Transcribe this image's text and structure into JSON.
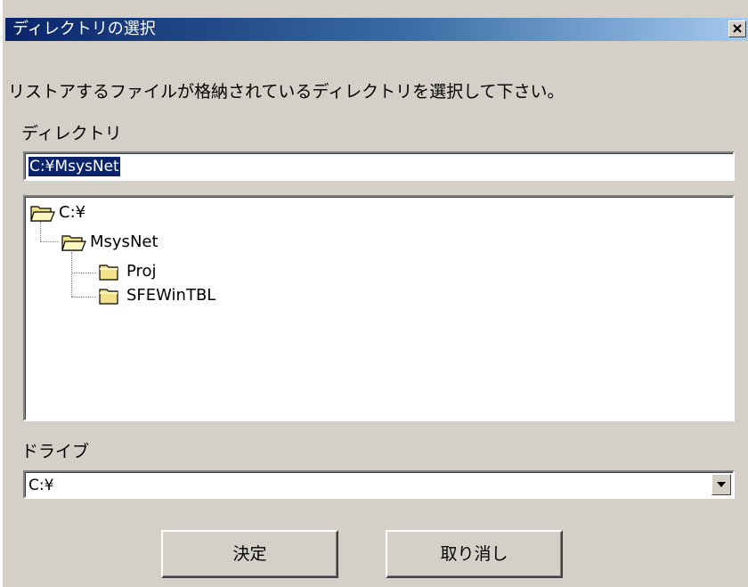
{
  "window": {
    "title": "ディレクトリの選択",
    "instruction": "リストアするファイルが格納されているディレクトリを選択して下さい。"
  },
  "directory": {
    "label": "ディレクトリ",
    "value": "C:¥MsysNet"
  },
  "tree": {
    "items": [
      {
        "label": "C:¥",
        "icon": "folder-open-icon"
      },
      {
        "label": "MsysNet",
        "icon": "folder-open-icon"
      },
      {
        "label": "Proj",
        "icon": "folder-icon"
      },
      {
        "label": "SFEWinTBL",
        "icon": "folder-icon"
      }
    ]
  },
  "drive": {
    "label": "ドライブ",
    "value": "C:¥"
  },
  "buttons": {
    "ok": "決定",
    "cancel": "取り消し"
  },
  "colors": {
    "title_bar_start": "#0a246a",
    "title_bar_end": "#a6caf0",
    "selection": "#0a246a",
    "dialog_face": "#d4d0c8",
    "folder": "#f3e08a"
  }
}
